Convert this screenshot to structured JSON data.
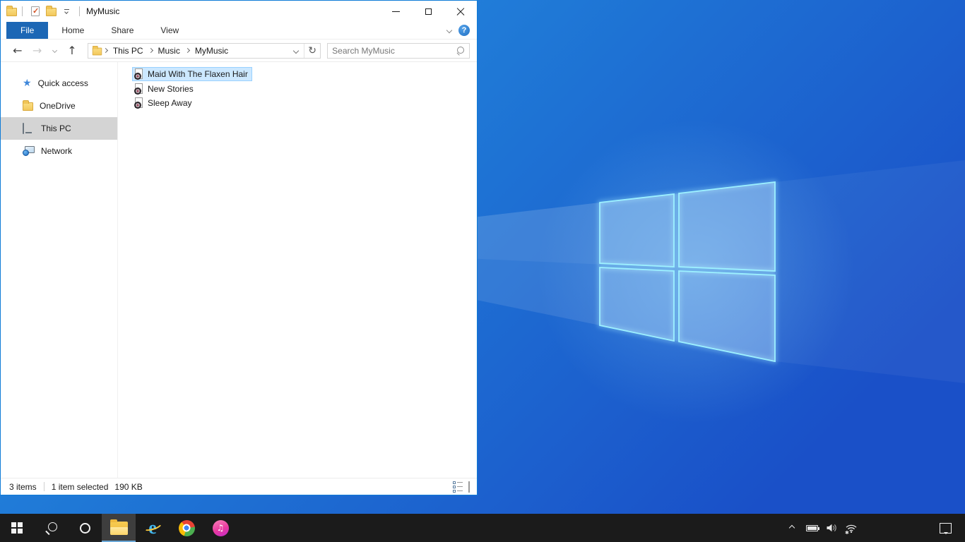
{
  "theme": {
    "accent_border": "#0f7bd7",
    "file_tab_bg": "#1c67b5",
    "selection_bg": "#cce8ff",
    "selection_border": "#99d1ff",
    "sidebar_selected_bg": "#d4d4d4",
    "taskbar_bg": "#1b1b1b",
    "taskbar_underline": "#6ba8d8",
    "desktop_gradient": [
      "#2490e6",
      "#1b55cb"
    ],
    "logo_stroke": "#9df1ff"
  },
  "titlebar": {
    "title": "MyMusic",
    "qat_properties_glyph": "✓",
    "controls": {
      "minimize": "minimize",
      "maximize": "maximize",
      "close": "close"
    }
  },
  "ribbon": {
    "tabs": [
      "File",
      "Home",
      "Share",
      "View"
    ],
    "active_tab": "File",
    "help_glyph": "?"
  },
  "navbar": {
    "back_glyph": "←",
    "forward_glyph": "→",
    "up_glyph": "↑",
    "refresh_glyph": "↻",
    "breadcrumb": [
      "This PC",
      "Music",
      "MyMusic"
    ],
    "search_placeholder": "Search MyMusic"
  },
  "sidebar": {
    "items": [
      {
        "label": "Quick access",
        "icon": "quick-access-star"
      },
      {
        "label": "OneDrive",
        "icon": "onedrive-folder"
      },
      {
        "label": "This PC",
        "icon": "this-pc-monitor",
        "selected": true
      },
      {
        "label": "Network",
        "icon": "network-globe"
      }
    ]
  },
  "files": [
    {
      "name": "Maid With The Flaxen Hair",
      "selected": true
    },
    {
      "name": "New Stories",
      "selected": false
    },
    {
      "name": "Sleep Away",
      "selected": false
    }
  ],
  "statusbar": {
    "count": "3 items",
    "selected": "1 item selected",
    "size": "190 KB"
  },
  "taskbar": {
    "itunes_note_glyph": "♫",
    "buttons": [
      "start",
      "search",
      "cortana",
      "file-explorer",
      "internet-explorer",
      "chrome",
      "itunes"
    ],
    "active_button": "file-explorer",
    "tray": [
      "hidden-icons-expand",
      "battery",
      "volume",
      "wifi",
      "action-center"
    ]
  }
}
